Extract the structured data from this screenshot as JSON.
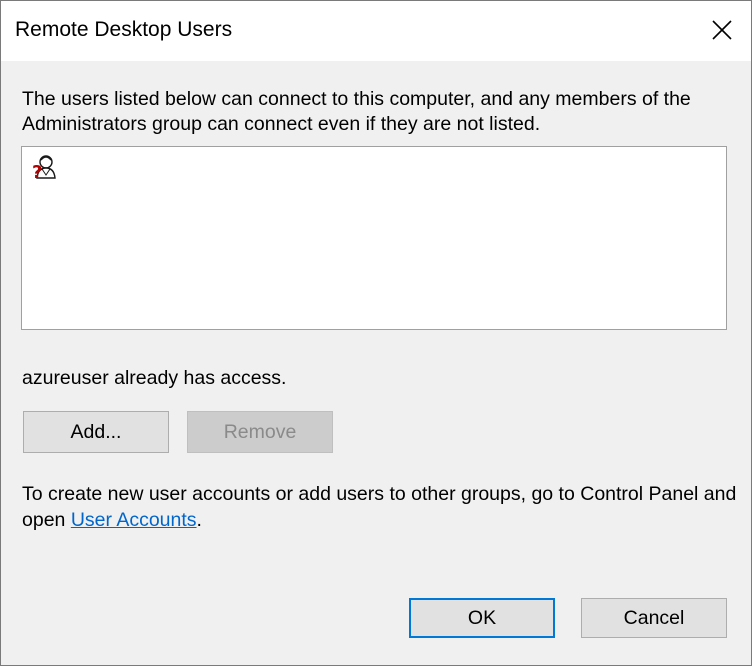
{
  "window": {
    "title": "Remote Desktop Users",
    "close_icon": "close-icon"
  },
  "description": "The users listed below can connect to this computer, and any members of the Administrators group can connect even if they are not listed.",
  "user_list": {
    "items": [
      {
        "icon": "unknown-user-icon",
        "label": ""
      }
    ]
  },
  "access_status": "azureuser already has access.",
  "buttons": {
    "add_label": "Add...",
    "remove_label": "Remove",
    "ok_label": "OK",
    "cancel_label": "Cancel"
  },
  "footer": {
    "text_before_link": "To create new user accounts or add users to other groups, go to Control Panel and open ",
    "link_label": "User Accounts",
    "text_after_link": "."
  },
  "colors": {
    "accent": "#0078d7",
    "link": "#0066cc",
    "dialog_background": "#f0f0f0",
    "button_background": "#e1e1e1",
    "disabled_text": "#8a8a8a"
  }
}
